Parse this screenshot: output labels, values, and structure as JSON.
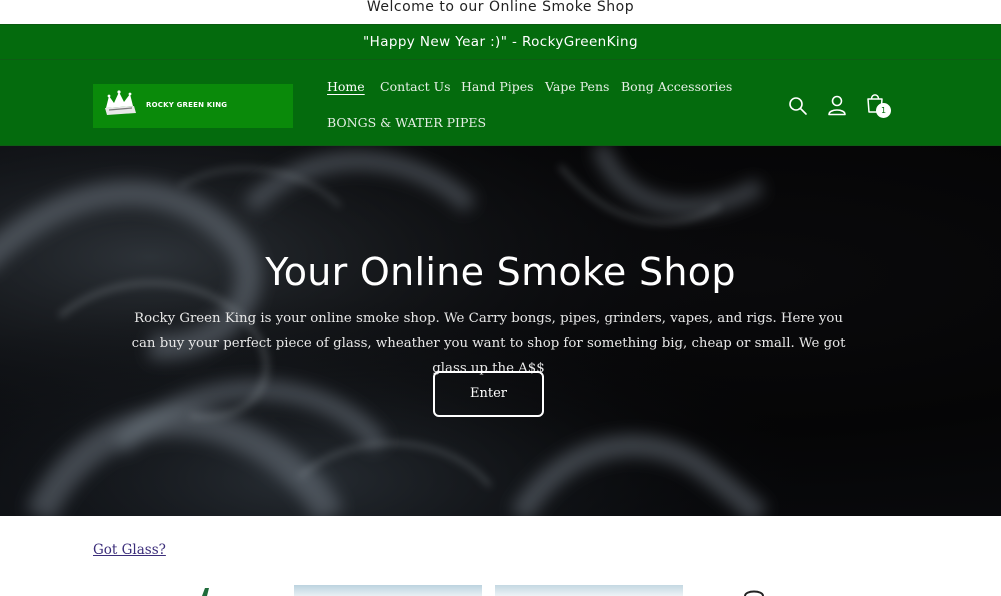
{
  "topbar": {
    "text": "Welcome to our Online Smoke Shop"
  },
  "announcement": {
    "text": "\"Happy New Year :)\" - RockyGreenKing"
  },
  "header": {
    "logo_text": "ROCKY GREEN KING",
    "nav": [
      {
        "label": "Home",
        "active": true
      },
      {
        "label": "Contact Us"
      },
      {
        "label": "Hand Pipes"
      },
      {
        "label": "Vape Pens"
      },
      {
        "label": "Bong Accessories"
      },
      {
        "label": "BONGS & WATER PIPES"
      }
    ],
    "icons": [
      "search-icon",
      "account-icon",
      "cart-icon"
    ],
    "cart_count": "1"
  },
  "hero": {
    "title": "Your Online Smoke Shop",
    "text": "Rocky Green King is your online smoke shop. We Carry bongs, pipes, grinders, vapes, and rigs. Here you can buy your perfect piece of glass, wheather you want to shop for something big, cheap or small. We got glass up the A$$",
    "button_label": "Enter"
  },
  "collection": {
    "link_label": "Got Glass?"
  },
  "colors": {
    "brand_green": "#046b0d",
    "hero_bg": "#050506",
    "link": "#3b2d7a"
  }
}
